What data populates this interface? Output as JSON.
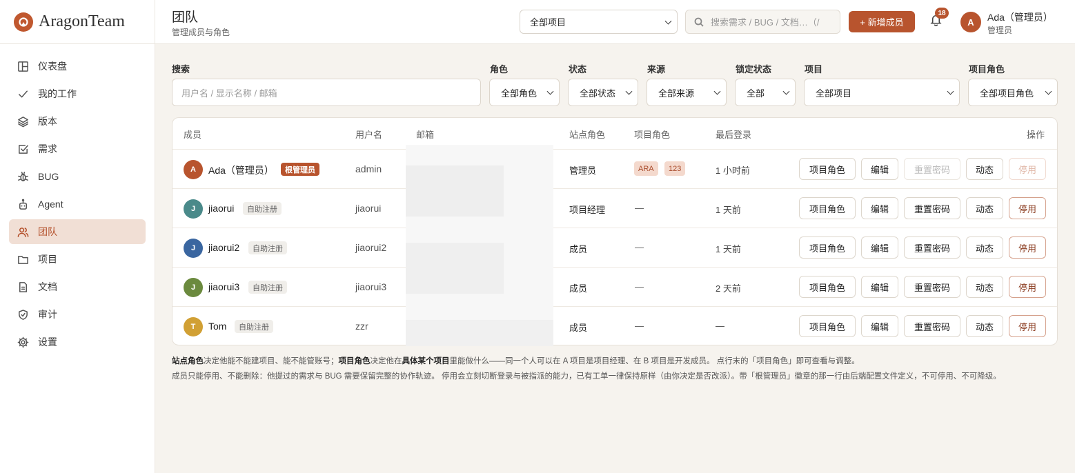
{
  "brand": {
    "name": "AragonTeam"
  },
  "sidebar": {
    "items": [
      {
        "label": "仪表盘",
        "icon": "dashboard-icon",
        "active": false
      },
      {
        "label": "我的工作",
        "icon": "check-icon",
        "active": false
      },
      {
        "label": "版本",
        "icon": "layers-icon",
        "active": false
      },
      {
        "label": "需求",
        "icon": "checkbox-icon",
        "active": false
      },
      {
        "label": "BUG",
        "icon": "bug-icon",
        "active": false
      },
      {
        "label": "Agent",
        "icon": "robot-icon",
        "active": false
      },
      {
        "label": "团队",
        "icon": "users-icon",
        "active": true
      },
      {
        "label": "项目",
        "icon": "folder-icon",
        "active": false
      },
      {
        "label": "文档",
        "icon": "document-icon",
        "active": false
      },
      {
        "label": "审计",
        "icon": "shield-icon",
        "active": false
      },
      {
        "label": "设置",
        "icon": "gear-icon",
        "active": false
      }
    ]
  },
  "header": {
    "title": "团队",
    "subtitle": "管理成员与角色",
    "project_select": "全部项目",
    "search_placeholder": "搜索需求 / BUG / 文档…（/",
    "new_member": "+ 新增成员",
    "notification_count": "18",
    "user": {
      "avatar": "A",
      "name": "Ada（管理员）",
      "role": "管理员"
    }
  },
  "filters": {
    "search_label": "搜索",
    "search_placeholder": "用户名 / 显示名称 / 邮箱",
    "role_label": "角色",
    "role_value": "全部角色",
    "status_label": "状态",
    "status_value": "全部状态",
    "source_label": "来源",
    "source_value": "全部来源",
    "lock_label": "锁定状态",
    "lock_value": "全部",
    "project_label": "项目",
    "project_value": "全部项目",
    "project_role_label": "项目角色",
    "project_role_value": "全部项目角色"
  },
  "table": {
    "headers": {
      "member": "成员",
      "username": "用户名",
      "email": "邮箱",
      "site_role": "站点角色",
      "project_role": "项目角色",
      "last_login": "最后登录",
      "actions": "操作"
    },
    "actions": {
      "project_role": "项目角色",
      "edit": "编辑",
      "reset_password": "重置密码",
      "activity": "动态",
      "disable": "停用"
    },
    "rows": [
      {
        "avatar": "A",
        "avatar_color": "#b8542e",
        "name": "Ada（管理员）",
        "tag": "根管理员",
        "username": "admin",
        "site_role": "管理员",
        "project_roles": [
          "ARA",
          "123"
        ],
        "last_login": "1 小时前",
        "protected": true
      },
      {
        "avatar": "J",
        "avatar_color": "#4a8a8a",
        "name": "jiaorui",
        "tag": "自助注册",
        "username": "jiaorui",
        "site_role": "项目经理",
        "project_roles_text": "—",
        "last_login": "1 天前",
        "protected": false
      },
      {
        "avatar": "J",
        "avatar_color": "#3a66a0",
        "name": "jiaorui2",
        "tag": "自助注册",
        "username": "jiaorui2",
        "site_role": "成员",
        "project_roles_text": "—",
        "last_login": "1 天前",
        "protected": false
      },
      {
        "avatar": "J",
        "avatar_color": "#6b8a3e",
        "name": "jiaorui3",
        "tag": "自助注册",
        "username": "jiaorui3",
        "site_role": "成员",
        "project_roles_text": "—",
        "last_login": "2 天前",
        "protected": false
      },
      {
        "avatar": "T",
        "avatar_color": "#d1a034",
        "name": "Tom",
        "tag": "自助注册",
        "username": "zzr",
        "site_role": "成员",
        "project_roles_text": "—",
        "last_login": "—",
        "protected": false
      }
    ]
  },
  "notes": {
    "line1_b1": "站点角色",
    "line1_t1": "决定他能不能建项目、能不能管账号；",
    "line1_b2": "项目角色",
    "line1_t2": "决定他在",
    "line1_b3": "具体某个项目",
    "line1_t3": "里能做什么——同一个人可以在 A 项目是项目经理、在 B 项目是开发成员。 点行末的「项目角色」即可查看与调整。",
    "line2": "成员只能停用、不能删除：他提过的需求与 BUG 需要保留完整的协作轨迹。 停用会立刻切断登录与被指派的能力，已有工单一律保持原样（由你决定是否改派）。带「根管理员」徽章的那一行由后端配置文件定义，不可停用、不可降级。"
  }
}
